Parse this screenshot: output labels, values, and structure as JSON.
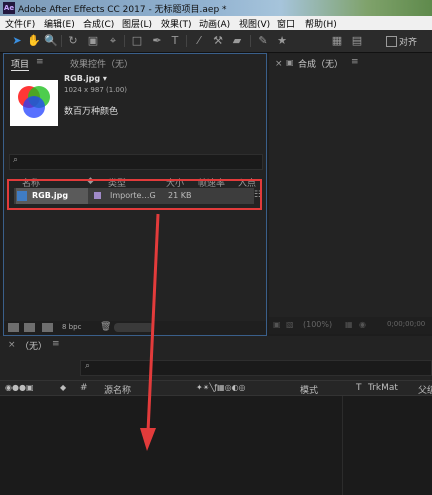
{
  "window": {
    "title": "Adobe After Effects CC 2017 - 无标题项目.aep *",
    "icon": "Ae"
  },
  "menu": [
    "文件(F)",
    "编辑(E)",
    "合成(C)",
    "图层(L)",
    "效果(T)",
    "动画(A)",
    "视图(V)",
    "窗口",
    "帮助(H)"
  ],
  "toolbar": {
    "tools": [
      "selection-tool",
      "hand-tool",
      "zoom-tool",
      "rotate-tool",
      "camera-tool",
      "pan-behind-tool",
      "rectangle-tool",
      "pen-tool",
      "type-tool",
      "brush-tool",
      "clone-stamp-tool",
      "eraser-tool",
      "roto-brush-tool",
      "puppet-tool"
    ],
    "align_label": "对齐"
  },
  "project_panel": {
    "tab_project": "项目",
    "tab_effects": "效果控件（无）",
    "file_name": "RGB.jpg ▾",
    "file_dims": "1024 x 987 (1.00)",
    "file_colors": "数百万种颜色",
    "columns": [
      "名称",
      "类型",
      "大小",
      "帧速率",
      "入点"
    ],
    "rows": [
      {
        "name": "RGB.jpg",
        "type": "Importe…G",
        "size": "21 KB"
      }
    ],
    "bpc": "8 bpc"
  },
  "composition_panel": {
    "title": "合成（无）",
    "zoom": "(100%)",
    "timecode": "0;00;00;00"
  },
  "timeline": {
    "tab": "（无）",
    "columns": [
      "#",
      "源名称",
      "模式",
      "T",
      "TrkMat",
      "父级"
    ]
  },
  "colors": {
    "highlight": "#e23b3b",
    "accent": "#3a8fe0"
  }
}
